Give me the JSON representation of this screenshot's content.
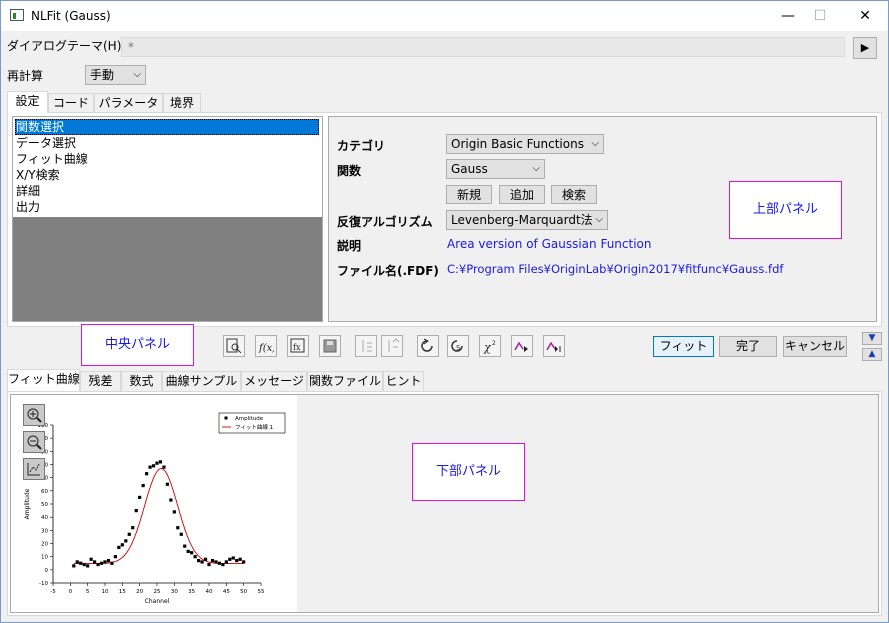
{
  "window": {
    "title": "NLFit (Gauss)",
    "controls": {
      "minimize": "—",
      "maximize": "☐",
      "close": "✕"
    }
  },
  "theme": {
    "label": "ダイアログテーマ(H)",
    "value": "*",
    "arrow": "▶"
  },
  "recalc": {
    "label": "再計算",
    "value": "手動"
  },
  "top_tabs": [
    "設定",
    "コード",
    "パラメータ",
    "境界"
  ],
  "settings_list": [
    "関数選択",
    "データ選択",
    "フィット曲線",
    "X/Y検索",
    "詳細",
    "出力"
  ],
  "form": {
    "category_label": "カテゴリ",
    "category_value": "Origin Basic Functions",
    "function_label": "関数",
    "function_value": "Gauss",
    "btn_new": "新規",
    "btn_add": "追加",
    "btn_search": "検索",
    "algorithm_label": "反復アルゴリズム",
    "algorithm_value": "Levenberg-Marquardt法",
    "desc_label": "説明",
    "desc_value": "Area version of Gaussian Function",
    "file_label": "ファイル名(.FDF)",
    "file_value": "C:¥Program Files¥OriginLab¥Origin2017¥fitfunc¥Gauss.fdf"
  },
  "annotations": {
    "upper": "上部パネル",
    "middle": "中央パネル",
    "lower": "下部パネル"
  },
  "actions": {
    "fit": "フィット",
    "done": "完了",
    "cancel": "キャンセル"
  },
  "bottom_tabs": [
    "フィット曲線",
    "残差",
    "数式",
    "曲線サンプル",
    "メッセージ",
    "関数ファイル",
    "ヒント"
  ],
  "colors": {
    "accent": "#0078d7",
    "annotation_border": "#e010e0",
    "annotation_text": "#1a1ae6",
    "fit_curve": "#cc0000"
  },
  "chart_data": {
    "type": "scatter",
    "xlabel": "Channel",
    "ylabel": "Amplitude",
    "xlim": [
      -5,
      55
    ],
    "ylim": [
      -10,
      110
    ],
    "xticks": [
      -5,
      0,
      5,
      10,
      15,
      20,
      25,
      30,
      35,
      40,
      45,
      50,
      55
    ],
    "yticks": [
      -10,
      0,
      10,
      20,
      30,
      40,
      50,
      60,
      70,
      80,
      90,
      100,
      110
    ],
    "legend": {
      "position": "top-right",
      "entries": [
        "Amplitude",
        "フィット曲線 1"
      ]
    },
    "series": [
      {
        "name": "Amplitude",
        "kind": "scatter",
        "x": [
          1,
          2,
          3,
          4,
          5,
          6,
          7,
          8,
          9,
          10,
          11,
          12,
          13,
          14,
          15,
          16,
          17,
          18,
          19,
          20,
          21,
          22,
          23,
          24,
          25,
          26,
          27,
          28,
          29,
          30,
          31,
          32,
          33,
          34,
          35,
          36,
          37,
          38,
          39,
          40,
          41,
          42,
          43,
          44,
          45,
          46,
          47,
          48,
          49,
          50
        ],
        "y": [
          3,
          6,
          5,
          4,
          3,
          8,
          6,
          4,
          5,
          6,
          7,
          5,
          10,
          17,
          19,
          22,
          27,
          32,
          45,
          55,
          64,
          73,
          78,
          79,
          81,
          82,
          78,
          65,
          53,
          44,
          32,
          27,
          18,
          14,
          13,
          10,
          7,
          6,
          8,
          4,
          7,
          6,
          5,
          4,
          6,
          8,
          9,
          7,
          8,
          6
        ]
      },
      {
        "name": "フィット曲線 1",
        "kind": "line",
        "fn": {
          "y0": 4.7,
          "xc": 26.2,
          "w": 9.6,
          "A": 869
        }
      }
    ]
  }
}
